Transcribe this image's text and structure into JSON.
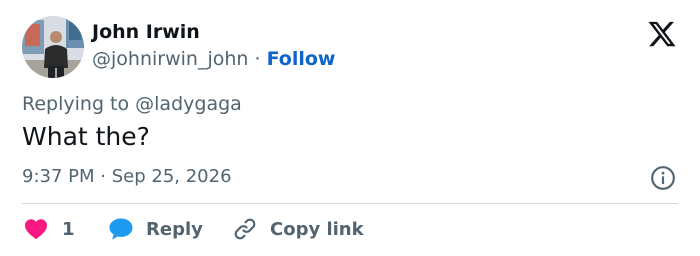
{
  "author": {
    "name": "John Irwin",
    "handle": "@johnirwin_john",
    "separator": "·",
    "follow_label": "Follow"
  },
  "tweet": {
    "reply_context": "Replying to @ladygaga",
    "text": "What the?",
    "time": "9:37 PM",
    "separator": "·",
    "date": "Sep 25, 2026"
  },
  "actions": {
    "like_count": "1",
    "reply_label": "Reply",
    "copy_link_label": "Copy link"
  },
  "icons": {
    "logo": "x-logo-icon",
    "info": "info-icon",
    "like": "heart-icon",
    "reply": "speech-bubble-icon",
    "copy": "link-icon"
  },
  "colors": {
    "text_primary": "#0f1419",
    "text_secondary": "#536471",
    "follow": "#0f64c8",
    "heart": "#f91880",
    "reply_bubble": "#1d9bf0",
    "divider": "#cfd9de"
  }
}
